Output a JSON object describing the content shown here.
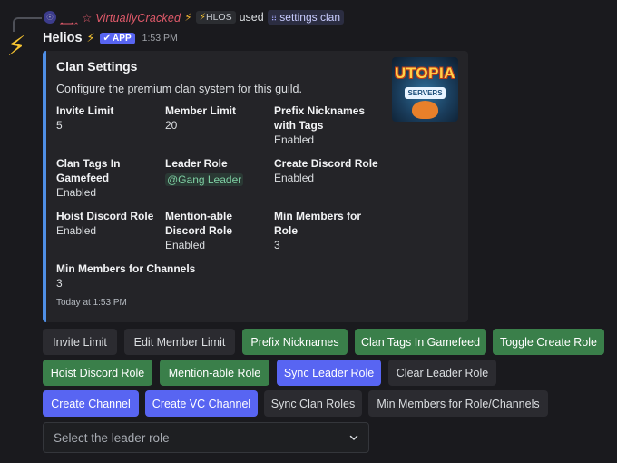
{
  "reply": {
    "avatar_icon": "bolt-mini-icon",
    "user_name": "☆ VirtuallyCracked",
    "name_prefix": "ꞈ̲̲̲ ̲̲̲ ̲̲̲ꞈꞈ",
    "user_tag": "HLOS",
    "used_text": "used",
    "command": "settings clan"
  },
  "message": {
    "author": "Helios",
    "app_badge": "APP",
    "timestamp": "1:53 PM"
  },
  "embed": {
    "accent_color": "#4f8fe6",
    "title": "Clan Settings",
    "description": "Configure the premium clan system for this guild.",
    "thumbnail": {
      "line1": "UTOPIA",
      "line2": "SERVERS"
    },
    "fields": [
      {
        "name": "Invite Limit",
        "value": "5"
      },
      {
        "name": "Member Limit",
        "value": "20"
      },
      {
        "name": "Prefix Nicknames with Tags",
        "value": "Enabled"
      },
      {
        "name": "Clan Tags In Gamefeed",
        "value": "Enabled"
      },
      {
        "name": "Leader Role",
        "value": "@Gang Leader"
      },
      {
        "name": "Create Discord Role",
        "value": "Enabled"
      },
      {
        "name": "Hoist Discord Role",
        "value": "Enabled"
      },
      {
        "name": "Mention-able Discord Role",
        "value": "Enabled"
      },
      {
        "name": "Min Members for Role",
        "value": "3"
      },
      {
        "name": "Min Members for Channels",
        "value": "3"
      }
    ],
    "footer": "Today at 1:53 PM"
  },
  "buttons": {
    "invite_limit": "Invite Limit",
    "edit_member_limit": "Edit Member Limit",
    "prefix_nicknames": "Prefix Nicknames",
    "clan_tags_gamefeed": "Clan Tags In Gamefeed",
    "toggle_create_role": "Toggle Create Role",
    "hoist_discord_role": "Hoist Discord Role",
    "mentionable_role": "Mention-able Role",
    "sync_leader_role": "Sync Leader Role",
    "clear_leader_role": "Clear Leader Role",
    "create_channel": "Create Channel",
    "create_vc_channel": "Create VC Channel",
    "sync_clan_roles": "Sync Clan Roles",
    "min_members": "Min Members for Role/Channels"
  },
  "select": {
    "placeholder": "Select the leader role"
  },
  "colors": {
    "green_button": "#3a7f4a",
    "blue_button": "#5865f2",
    "grey_button": "#2b2b30",
    "bolt": "#f6c431"
  }
}
